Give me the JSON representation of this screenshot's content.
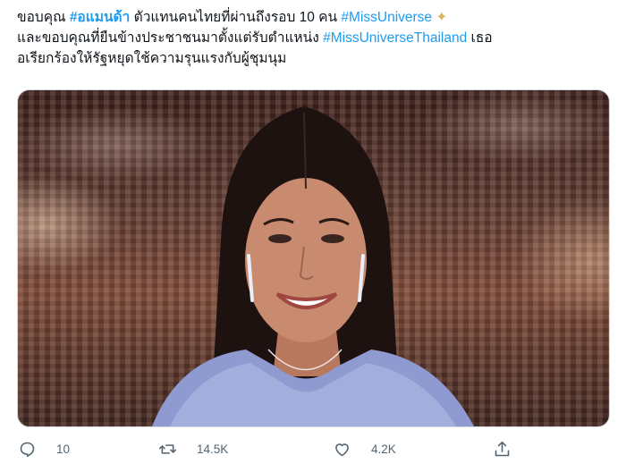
{
  "tweet": {
    "line1_prefix": "ขอบคุณ ",
    "hashtag_amanda": "#อแมนด้า",
    "line1_mid": " ตัวแทนคนไทยที่ผ่านถึงรอบ 10 คน ",
    "hashtag_missuniverse": "#MissUniverse",
    "sparkle": "✦",
    "line2_prefix": " และขอบคุณที่ยืนข้างประชาชนมาตั้งแต่รับตำแหน่ง ",
    "hashtag_missuniversethailand": "#MissUniverseThailand",
    "line2_suffix": " เธอ",
    "line3": "อเรียกร้องให้รัฐหยุดใช้ความรุนแรงกับผู้ชุมนุม"
  },
  "actions": {
    "reply_count": "10",
    "retweet_count": "14.5K",
    "like_count": "4.2K"
  },
  "colors": {
    "hashtag": "#1d9bf0",
    "text": "#0f1419",
    "muted": "#536471"
  },
  "icons": {
    "reply": "reply-icon",
    "retweet": "retweet-icon",
    "like": "heart-icon",
    "share": "share-icon"
  }
}
